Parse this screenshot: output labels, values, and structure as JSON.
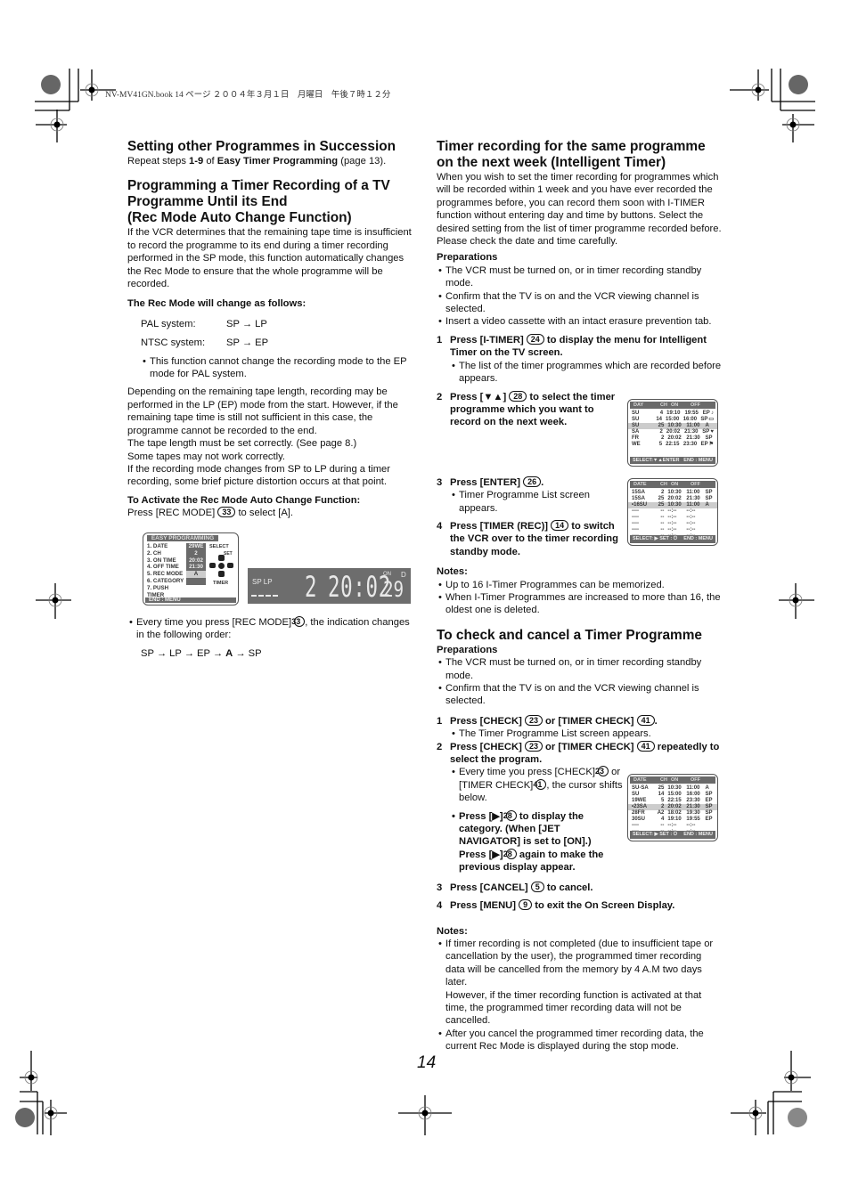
{
  "print_header": "NV-MV41GN.book  14 ページ  ２００４年３月１日　月曜日　午後７時１２分",
  "left": {
    "s1_title": "Setting other Programmes in Succession",
    "s1_text_pre": "Repeat steps ",
    "s1_text_steps": "1-9",
    "s1_text_mid": " of ",
    "s1_text_ref": "Easy Timer Programming",
    "s1_text_post": " (page 13).",
    "s2_title_1": "Programming a Timer Recording of a TV",
    "s2_title_2": "Programme Until its End",
    "s2_title_3": "(Rec Mode Auto Change Function)",
    "s2_intro": "If the VCR determines that the remaining tape time is insufficient to record the programme to its end during a timer recording performed in the SP mode, this function automatically changes the Rec Mode to ensure that the whole programme will be recorded.",
    "change_heading": "The Rec Mode will change as follows:",
    "pal_label": "PAL system:",
    "pal_value": "SP → LP",
    "ntsc_label": "NTSC system:",
    "ntsc_value": "SP → EP",
    "bullet_pal": "This function cannot change the recording mode to the EP mode for PAL system.",
    "para_depending": "Depending on the remaining tape length, recording may be performed in the LP (EP) mode from the start. However, if the remaining tape time is still not sufficient in this case, the programme cannot be recorded to the end.",
    "para_tape": "The tape length must be set correctly. (See page 8.)",
    "para_some": "Some tapes may not work correctly.",
    "para_if": "If the recording mode changes from SP to LP during a timer recording, some brief picture distortion occurs at that point.",
    "activate_heading": "To Activate the Rec Mode Auto Change Function:",
    "activate_pre": "Press [REC MODE] ",
    "activate_btn": "33",
    "activate_post": " to select [A].",
    "every_pre": "Every time you press [REC MODE] ",
    "every_btn": "33",
    "every_post": ", the indication changes in the following order:",
    "order_pre": "SP → LP → EP → ",
    "order_bold": "A",
    "order_post": " → SP"
  },
  "easy_osd": {
    "title": "EASY PROGRAMMING",
    "rows": [
      {
        "label": "1. DATE",
        "value": "29WE"
      },
      {
        "label": "2. CH",
        "value": "2"
      },
      {
        "label": "3. ON TIME",
        "value": "20:02"
      },
      {
        "label": "4. OFF TIME",
        "value": "21:30"
      },
      {
        "label": "5. REC MODE",
        "value": "A"
      },
      {
        "label": "6. CATEGORY",
        "value": ""
      },
      {
        "label": "7. PUSH TIMER",
        "value": ""
      }
    ],
    "select": "SELECT",
    "set": "SET",
    "timer": "TIMER",
    "footer": "END : MENU"
  },
  "lcd": {
    "modes": "SP LP",
    "channel": "2",
    "time": "20:02",
    "on": "ON",
    "d": "D",
    "date": "29"
  },
  "right": {
    "s3_title_1": "Timer recording for the same programme",
    "s3_title_2": "on the next week (Intelligent Timer)",
    "s3_intro": "When you wish to set the timer recording for programmes which will be recorded within 1 week and you have ever recorded the programmes before, you can record them soon with I-TIMER function without entering day and time by buttons. Select the desired setting from the list of timer programme recorded before. Please check the date and time carefully.",
    "prep_heading": "Preparations",
    "prep": [
      "The VCR must be turned on, or in timer recording standby mode.",
      "Confirm that the TV is on and the VCR viewing channel is selected.",
      "Insert a video cassette with an intact erasure prevention tab."
    ],
    "steps": [
      {
        "n": "1",
        "pre": "Press [I-TIMER] ",
        "btn": "24",
        "post": " to display the menu for Intelligent Timer on the TV screen.",
        "sub": "The list of the timer programmes which are recorded before appears."
      },
      {
        "n": "2",
        "pre": "Press [▼▲] ",
        "btn": "28",
        "post": " to select the timer programme which you want to record on the next week.",
        "sub": ""
      },
      {
        "n": "3",
        "pre": "Press [ENTER] ",
        "btn": "26",
        "post": ".",
        "sub": "Timer Programme List screen appears."
      },
      {
        "n": "4",
        "pre": "Press [TIMER (REC)] ",
        "btn": "14",
        "post": " to switch the VCR over to the timer recording standby mode.",
        "sub": ""
      }
    ],
    "notes_heading": "Notes:",
    "notes": [
      "Up to 16 I-Timer Programmes can be memorized.",
      "When I-Timer Programmes are increased to more than 16, the oldest one is deleted."
    ],
    "s4_title": "To check and cancel a Timer Programme",
    "prep2_heading": "Preparations",
    "prep2": [
      "The VCR must be turned on, or in timer recording standby mode.",
      "Confirm that the TV is on and the VCR viewing channel is selected."
    ],
    "c_step1_pre": "Press [CHECK] ",
    "c_step1_btn1": "23",
    "c_step1_mid": " or [TIMER CHECK] ",
    "c_step1_btn2": "41",
    "c_step1_post": ".",
    "c_step1_sub": "The Timer Programme List screen appears.",
    "c_step2_pre": "Press [CHECK] ",
    "c_step2_btn1": "23",
    "c_step2_mid": " or [TIMER CHECK] ",
    "c_step2_btn2": "41",
    "c_step2_post": " repeatedly to select the program.",
    "c_step2_sub1_pre": "Every time you press [CHECK] ",
    "c_step2_sub1_btn1": "23",
    "c_step2_sub1_mid": " or [TIMER CHECK] ",
    "c_step2_sub1_btn2": "41",
    "c_step2_sub1_post": ", the cursor shifts below.",
    "c_step2_sub2_pre": "Press [▶] ",
    "c_step2_sub2_btn": "28",
    "c_step2_sub2_mid": " to display the category. (When [JET NAVIGATOR] is set to [ON].) Press [▶] ",
    "c_step2_sub2_btn2": "28",
    "c_step2_sub2_post": " again to make the previous display appear.",
    "c_step3_pre": "Press [CANCEL] ",
    "c_step3_btn": "5",
    "c_step3_post": " to cancel.",
    "c_step4_pre": "Press [MENU] ",
    "c_step4_btn": "9",
    "c_step4_post": " to exit the On Screen Display.",
    "notes2_heading": "Notes:",
    "notes2_1": "If timer recording is not completed (due to insufficient tape or cancellation by the user), the programmed timer recording data will be cancelled from the memory by 4 A.M two days later.",
    "notes2_1b": "However, if the timer recording function is activated at that time, the programmed timer recording data will not be cancelled.",
    "notes2_2": "After you cancel the programmed timer recording data, the current Rec Mode is displayed during the stop mode."
  },
  "osd_itimer": {
    "headers": [
      "DAY",
      "CH",
      "ON",
      "OFF"
    ],
    "rows": [
      [
        "SU",
        "4",
        "19:10",
        "19:55",
        "EP",
        "♪"
      ],
      [
        "SU",
        "14",
        "15:00",
        "16:00",
        "SP",
        "▭"
      ],
      [
        "SU",
        "25",
        "10:30",
        "11:00",
        "A",
        ""
      ],
      [
        "SA",
        "2",
        "20:02",
        "21:30",
        "SP",
        "♥"
      ],
      [
        "FR",
        "2",
        "20:02",
        "21:30",
        "SP",
        ""
      ],
      [
        "WE",
        "5",
        "22:15",
        "23:30",
        "EP",
        "⚑"
      ]
    ],
    "selected": 2,
    "footer_left": "SELECT:▼▲ENTER",
    "footer_right": "END : MENU"
  },
  "osd_list1": {
    "headers": [
      "DATE",
      "CH",
      "ON",
      "OFF"
    ],
    "rows": [
      [
        "15SA",
        "2",
        "10:30",
        "11:00",
        "SP"
      ],
      [
        "15SA",
        "25",
        "20:02",
        "21:30",
        "SP"
      ],
      [
        "•16SU",
        "25",
        "10:30",
        "11:00",
        "A"
      ],
      [
        "----",
        "--",
        "--:--",
        "--:--",
        ""
      ],
      [
        "----",
        "--",
        "--:--",
        "--:--",
        ""
      ],
      [
        "----",
        "--",
        "--:--",
        "--:--",
        ""
      ],
      [
        "----",
        "--",
        "--:--",
        "--:--",
        ""
      ],
      [
        "----",
        "--",
        "--:--",
        "--:--",
        ""
      ]
    ],
    "selected": 2,
    "footer_left": "SELECT: ▶ SET : ⏻",
    "footer_right": "END : MENU"
  },
  "osd_list2": {
    "headers": [
      "DATE",
      "CH",
      "ON",
      "OFF"
    ],
    "rows": [
      [
        "SU-SA",
        "25",
        "10:30",
        "11:00",
        "A"
      ],
      [
        "SU",
        "14",
        "15:00",
        "16:00",
        "SP"
      ],
      [
        "19WE",
        "5",
        "22:15",
        "23:30",
        "EP"
      ],
      [
        "•23SA",
        "2",
        "20:02",
        "21:30",
        "SP"
      ],
      [
        "28FR",
        "A2",
        "18:02",
        "19:30",
        "SP"
      ],
      [
        "30SU",
        "4",
        "19:10",
        "19:55",
        "EP"
      ],
      [
        "----",
        "--",
        "--:--",
        "--:--",
        ""
      ],
      [
        "----",
        "--",
        "--:--",
        "--:--",
        ""
      ]
    ],
    "selected": 3,
    "footer_left": "SELECT: ▶ SET : ⏻",
    "footer_right": "END : MENU"
  },
  "page_number": "14"
}
